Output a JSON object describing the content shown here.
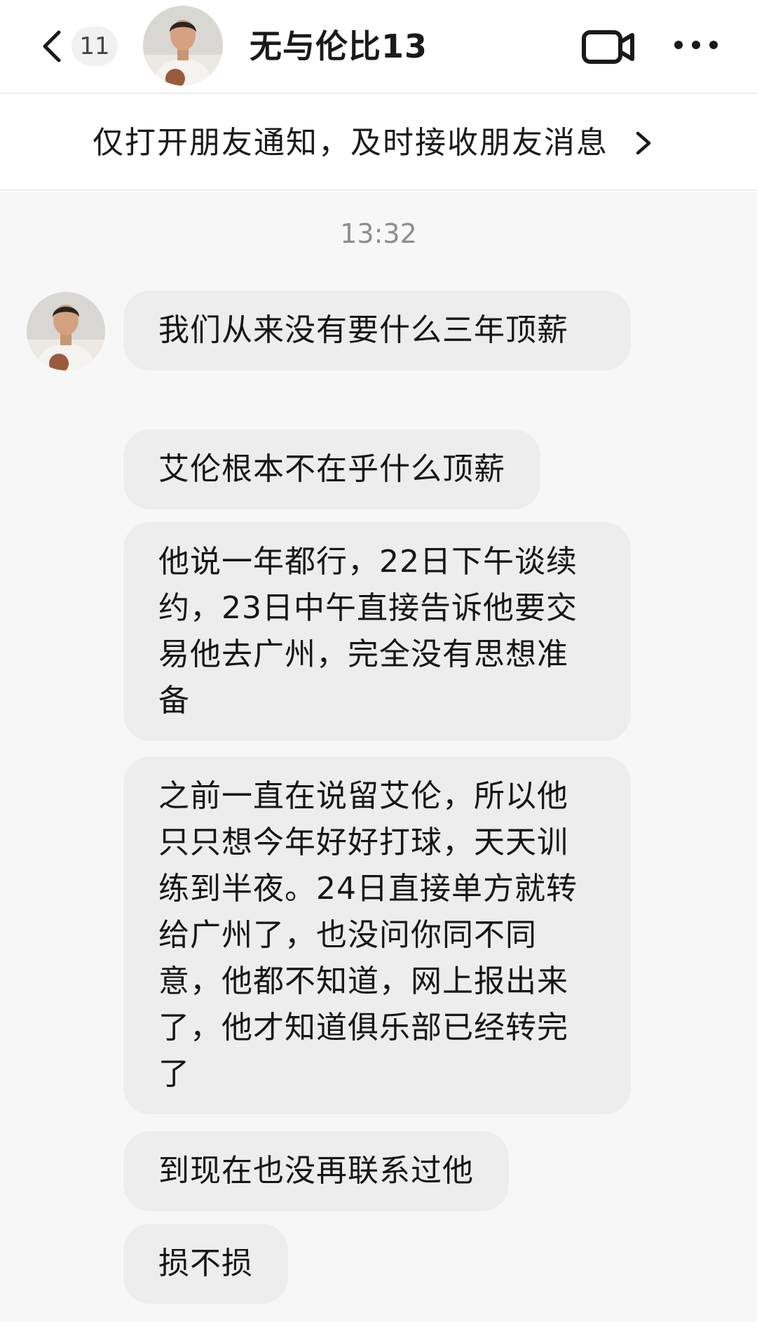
{
  "header": {
    "back_icon": "chevron-left-icon",
    "unread_count": "11",
    "avatar_icon": "contact-avatar",
    "title": "无与伦比13",
    "video_icon": "video-camera-icon",
    "more_icon": "more-dots-icon"
  },
  "notify_banner": {
    "text": "仅打开朋友通知，及时接收朋友消息",
    "chevron_icon": "chevron-right-icon"
  },
  "chat": {
    "timestamp": "13:32",
    "messages": [
      {
        "text": "我们从来没有要什么三年顶薪"
      },
      {
        "text": "艾伦根本不在乎什么顶薪"
      },
      {
        "text": "他说一年都行，22日下午谈续约，23日中午直接告诉他要交易他去广州，完全没有思想准备"
      },
      {
        "text": "之前一直在说留艾伦，所以他只只想今年好好打球，天天训练到半夜。24日直接单方就转给广州了，也没问你同不同意，他都不知道，网上报出来了，他才知道俱乐部已经转完了"
      },
      {
        "text": "到现在也没再联系过他"
      },
      {
        "text": "损不损"
      }
    ]
  },
  "colors": {
    "bubble": "#ededed",
    "chat_background": "#f7f7f7",
    "badge_background": "#f1f1f1"
  }
}
